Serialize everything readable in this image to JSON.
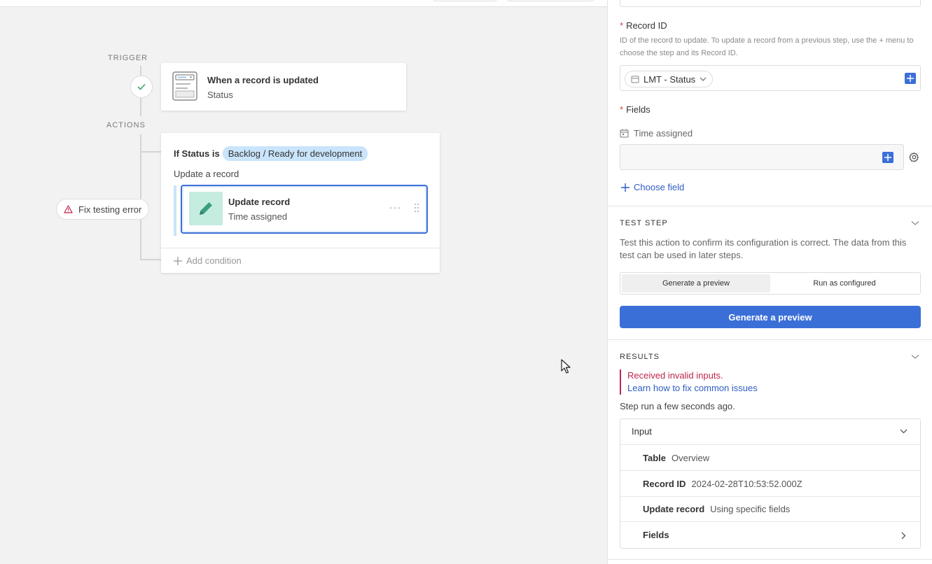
{
  "canvas": {
    "trigger_label": "TRIGGER",
    "actions_label": "ACTIONS",
    "trigger_card": {
      "title": "When a record is updated",
      "subtitle": "Status"
    },
    "condition": {
      "label": "If Status is",
      "value": "Backlog / Ready for development"
    },
    "update_label": "Update a record",
    "action_card": {
      "title": "Update record",
      "subtitle": "Time assigned",
      "menu": "···"
    },
    "add_condition": "Add condition",
    "fix_error": "Fix testing error"
  },
  "panel": {
    "record_id": {
      "label": "Record ID",
      "required": "*",
      "help": "ID of the record to update. To update a record from a previous step, use the + menu to choose the step and its Record ID.",
      "token": "LMT - Status"
    },
    "fields": {
      "label": "Fields",
      "required": "*",
      "field_name": "Time assigned",
      "choose_field": "Choose field"
    },
    "test_step": {
      "title": "TEST STEP",
      "description": "Test this action to confirm its configuration is correct. The data from this test can be used in later steps.",
      "tabs": [
        "Generate a preview",
        "Run as configured"
      ],
      "button": "Generate a preview"
    },
    "results": {
      "title": "RESULTS",
      "error": "Received invalid inputs.",
      "link": "Learn how to fix common issues",
      "step_run": "Step run a few seconds ago.",
      "input_header": "Input",
      "rows": [
        {
          "key": "Table",
          "value": "Overview"
        },
        {
          "key": "Record ID",
          "value": "2024-02-28T10:53:52.000Z"
        },
        {
          "key": "Update record",
          "value": "Using specific fields"
        },
        {
          "key": "Fields",
          "value": ""
        }
      ]
    }
  },
  "colors": {
    "accent": "#3b6fd8",
    "error": "#c0254f",
    "pill_bg": "#c9e4fb",
    "edit_tile": "#c4ecdf"
  }
}
